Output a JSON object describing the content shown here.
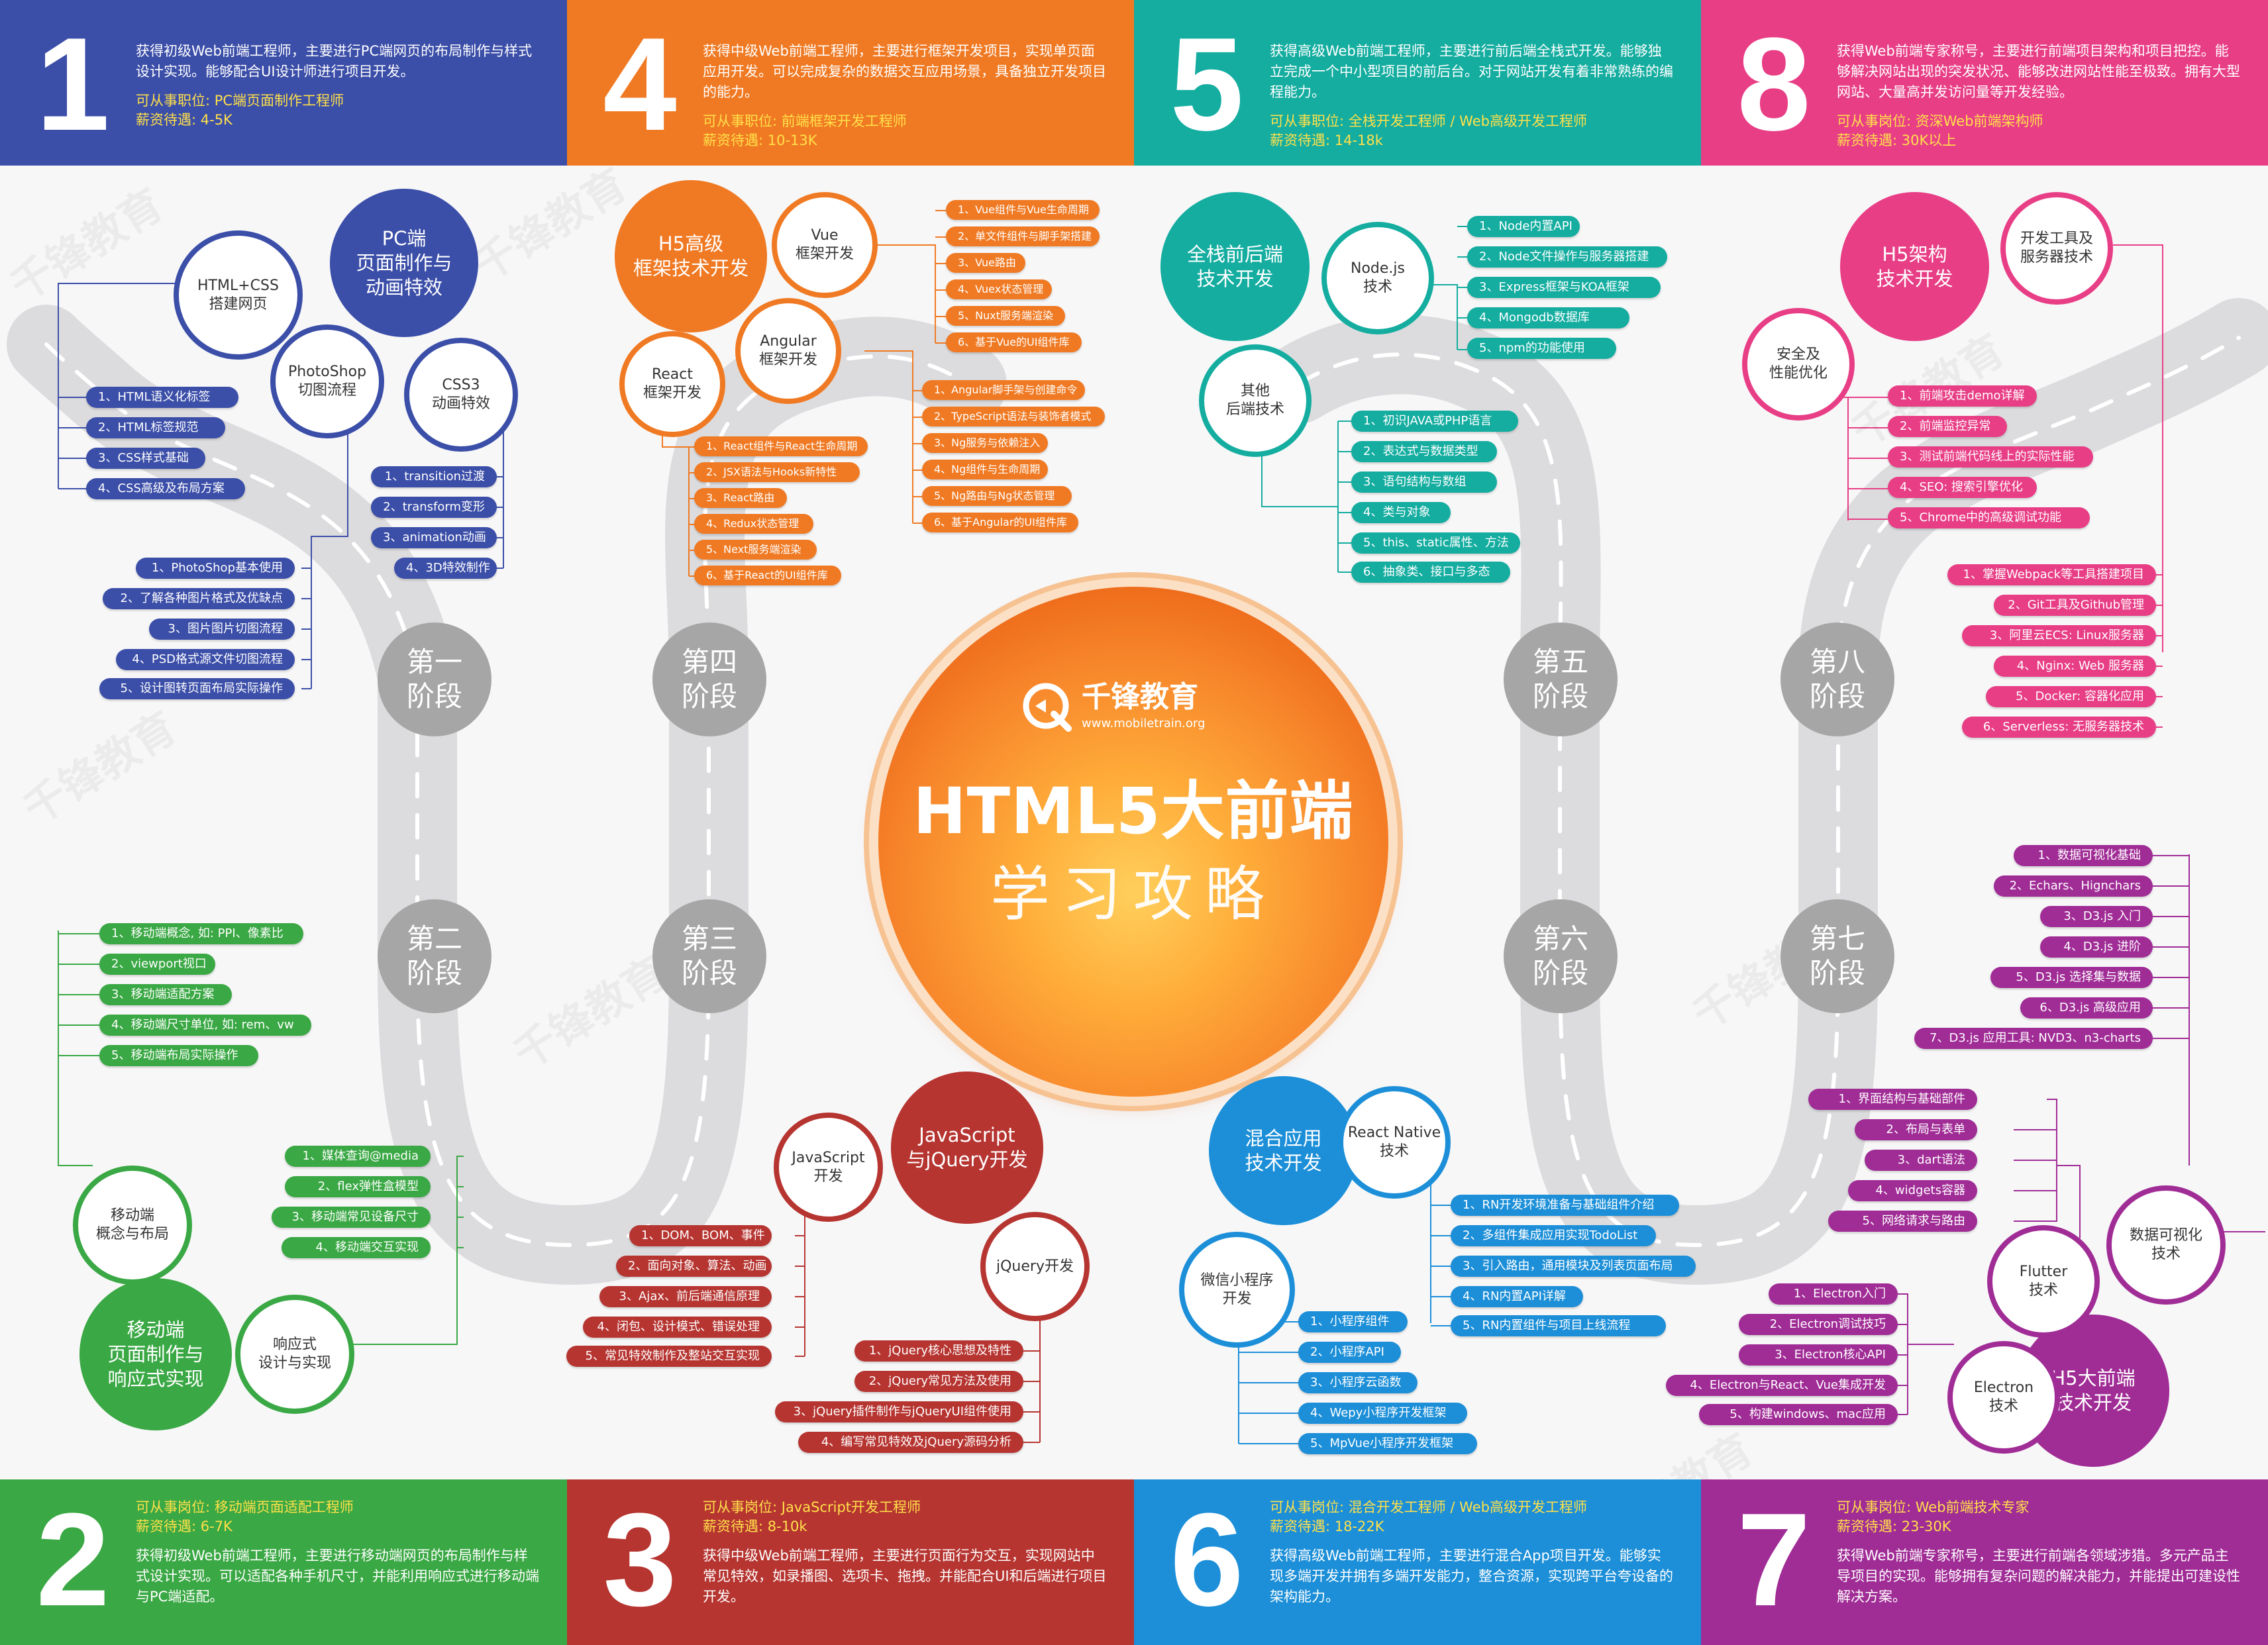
{
  "colors": {
    "blue": "#3b4ea8",
    "orange": "#f07a23",
    "teal": "#14ada0",
    "pink": "#e83e86",
    "green": "#3aa844",
    "red": "#b63531",
    "sky": "#1c8fd8",
    "purple": "#a02c96"
  },
  "header": {
    "p1": {
      "num": "1",
      "desc": "获得初级Web前端工程师，主要进行PC端网页的布局制作与样式设计实现。能够配合UI设计师进行项目开发。",
      "job": "可从事职位: PC端页面制作工程师",
      "salary": "薪资待遇: 4-5K"
    },
    "p4": {
      "num": "4",
      "desc": "获得中级Web前端工程师，主要进行框架开发项目，实现单页面应用开发。可以完成复杂的数据交互应用场景，具备独立开发项目的能力。",
      "job": "可从事职位: 前端框架开发工程师",
      "salary": "薪资待遇: 10-13K"
    },
    "p5": {
      "num": "5",
      "desc": "获得高级Web前端工程师，主要进行前后端全栈式开发。能够独立完成一个中小型项目的前后台。对于网站开发有着非常熟练的编程能力。",
      "job": "可从事职位: 全栈开发工程师 / Web高级开发工程师",
      "salary": "薪资待遇: 14-18k"
    },
    "p8": {
      "num": "8",
      "desc": "获得Web前端专家称号，主要进行前端项目架构和项目把控。能够解决网站出现的突发状况、能够改进网站性能至极致。拥有大型网站、大量高并发访问量等开发经验。",
      "job": "可从事岗位: 资深Web前端架构师",
      "salary": "薪资待遇: 30K以上"
    }
  },
  "footer": {
    "p2": {
      "num": "2",
      "job": "可从事岗位: 移动端页面适配工程师",
      "salary": "薪资待遇: 6-7K",
      "desc": "获得初级Web前端工程师，主要进行移动端网页的布局制作与样式设计实现。可以适配各种手机尺寸，并能利用响应式进行移动端与PC端适配。"
    },
    "p3": {
      "num": "3",
      "job": "可从事岗位: JavaScript开发工程师",
      "salary": "薪资待遇: 8-10k",
      "desc": "获得中级Web前端工程师，主要进行页面行为交互，实现网站中常见特效，如录播图、选项卡、拖拽。并能配合UI和后端进行项目开发。"
    },
    "p6": {
      "num": "6",
      "job": "可从事岗位: 混合开发工程师 / Web高级开发工程师",
      "salary": "薪资待遇: 18-22K",
      "desc": "获得高级Web前端工程师，主要进行混合App项目开发。能够实现多端开发并拥有多端开发能力，整合资源，实现跨平台夸设备的架构能力。"
    },
    "p7": {
      "num": "7",
      "job": "可从事岗位: Web前端技术专家",
      "salary": "薪资待遇: 23-30K",
      "desc": "获得Web前端专家称号，主要进行前端各领域涉猎。多元产品主导项目的实现。能够拥有复杂问题的解决能力，并能提出可建设性解决方案。"
    }
  },
  "center": {
    "logo": "千锋教育",
    "url": "www.mobiletrain.org",
    "title": "HTML5大前端",
    "subtitle": "学习攻略"
  },
  "watermark": "千锋教育",
  "stages": {
    "s1": "第一\n阶段",
    "s2": "第二\n阶段",
    "s3": "第三\n阶段",
    "s4": "第四\n阶段",
    "s5": "第五\n阶段",
    "s6": "第六\n阶段",
    "s7": "第七\n阶段",
    "s8": "第八\n阶段"
  },
  "g1": {
    "main": "PC端\n页面制作与\n动画特效",
    "html": "HTML+CSS\n搭建网页",
    "ps": "PhotoShop\n切图流程",
    "css3": "CSS3\n动画特效",
    "htmlItems": [
      "1、HTML语义化标签",
      "2、HTML标签规范",
      "3、CSS样式基础",
      "4、CSS高级及布局方案"
    ],
    "cssItems": [
      "1、transition过渡",
      "2、transform变形",
      "3、animation动画",
      "4、3D特效制作"
    ],
    "psItems": [
      "1、PhotoShop基本使用",
      "2、了解各种图片格式及优缺点",
      "3、图片图片切图流程",
      "4、PSD格式源文件切图流程",
      "5、设计图转页面布局实际操作"
    ]
  },
  "g4": {
    "main": "H5高级\n框架技术开发",
    "vue": "Vue\n框架开发",
    "angular": "Angular\n框架开发",
    "react": "React\n框架开发",
    "vueItems": [
      "1、Vue组件与Vue生命周期",
      "2、单文件组件与脚手架搭建",
      "3、Vue路由",
      "4、Vuex状态管理",
      "5、Nuxt服务端渲染",
      "6、基于Vue的UI组件库"
    ],
    "angItems": [
      "1、Angular脚手架与创建命令",
      "2、TypeScript语法与装饰者模式",
      "3、Ng服务与依赖注入",
      "4、Ng组件与生命周期",
      "5、Ng路由与Ng状态管理",
      "6、基于Angular的UI组件库"
    ],
    "reactItems": [
      "1、React组件与React生命周期",
      "2、JSX语法与Hooks新特性",
      "3、React路由",
      "4、Redux状态管理",
      "5、Next服务端渲染",
      "6、基于React的UI组件库"
    ]
  },
  "g5": {
    "main": "全栈前后端\n技术开发",
    "node": "Node.js\n技术",
    "other": "其他\n后端技术",
    "nodeItems": [
      "1、Node内置API",
      "2、Node文件操作与服务器搭建",
      "3、Express框架与KOA框架",
      "4、Mongodb数据库",
      "5、npm的功能使用"
    ],
    "otherItems": [
      "1、初识JAVA或PHP语言",
      "2、表达式与数据类型",
      "3、语句结构与数组",
      "4、类与对象",
      "5、this、static属性、方法",
      "6、抽象类、接口与多态"
    ]
  },
  "g8": {
    "main": "H5架构\n技术开发",
    "tools": "开发工具及\n服务器技术",
    "sec": "安全及\n性能优化",
    "secItems": [
      "1、前端攻击demo详解",
      "2、前端监控异常",
      "3、测试前端代码线上的实际性能",
      "4、SEO: 搜索引擎优化",
      "5、Chrome中的高级调试功能"
    ],
    "toolItems": [
      "1、掌握Webpack等工具搭建项目",
      "2、Git工具及Github管理",
      "3、阿里云ECS: Linux服务器",
      "4、Nginx: Web 服务器",
      "5、Docker: 容器化应用",
      "6、Serverless: 无服务器技术"
    ]
  },
  "g2": {
    "main": "移动端\n页面制作与\n响应式实现",
    "mob": "移动端\n概念与布局",
    "resp": "响应式\n设计与实现",
    "mobItems": [
      "1、移动端概念, 如: PPI、像素比",
      "2、viewport视口",
      "3、移动端适配方案",
      "4、移动端尺寸单位, 如: rem、vw",
      "5、移动端布局实际操作"
    ],
    "respItems": [
      "1、媒体查询@media",
      "2、flex弹性盒模型",
      "3、移动端常见设备尺寸",
      "4、移动端交互实现"
    ]
  },
  "g3": {
    "main": "JavaScript\n与jQuery开发",
    "js": "JavaScript\n开发",
    "jq": "jQuery开发",
    "jsItems": [
      "1、DOM、BOM、事件",
      "2、面向对象、算法、动画",
      "3、Ajax、前后端通信原理",
      "4、闭包、设计模式、错误处理",
      "5、常见特效制作及整站交互实现"
    ],
    "jqItems": [
      "1、jQuery核心思想及特性",
      "2、jQuery常见方法及使用",
      "3、jQuery插件制作与jQueryUI组件使用",
      "4、编写常见特效及jQuery源码分析"
    ]
  },
  "g6": {
    "main": "混合应用\n技术开发",
    "rn": "React Native\n技术",
    "mini": "微信小程序\n开发",
    "rnItems": [
      "1、RN开发环境准备与基础组件介绍",
      "2、多组件集成应用实现TodoList",
      "3、引入路由，通用模块及列表页面布局",
      "4、RN内置API详解",
      "5、RN内置组件与项目上线流程"
    ],
    "miniItems": [
      "1、小程序组件",
      "2、小程序API",
      "3、小程序云函数",
      "4、Wepy小程序开发框架",
      "5、MpVue小程序开发框架"
    ]
  },
  "g7": {
    "main": "H5大前端\n技术开发",
    "viz": "数据可视化\n技术",
    "flutter": "Flutter\n技术",
    "electron": "Electron\n技术",
    "vizItems": [
      "1、数据可视化基础",
      "2、Echars、Hignchars",
      "3、D3.js 入门",
      "4、D3.js 进阶",
      "5、D3.js 选择集与数据",
      "6、D3.js 高级应用",
      "7、D3.js 应用工具: NVD3、n3-charts"
    ],
    "flutterItems": [
      "1、界面结构与基础部件",
      "2、布局与表单",
      "3、dart语法",
      "4、widgets容器",
      "5、网络请求与路由"
    ],
    "electronItems": [
      "1、Electron入门",
      "2、Electron调试技巧",
      "3、Electron核心API",
      "4、Electron与React、Vue集成开发",
      "5、构建windows、mac应用"
    ]
  }
}
